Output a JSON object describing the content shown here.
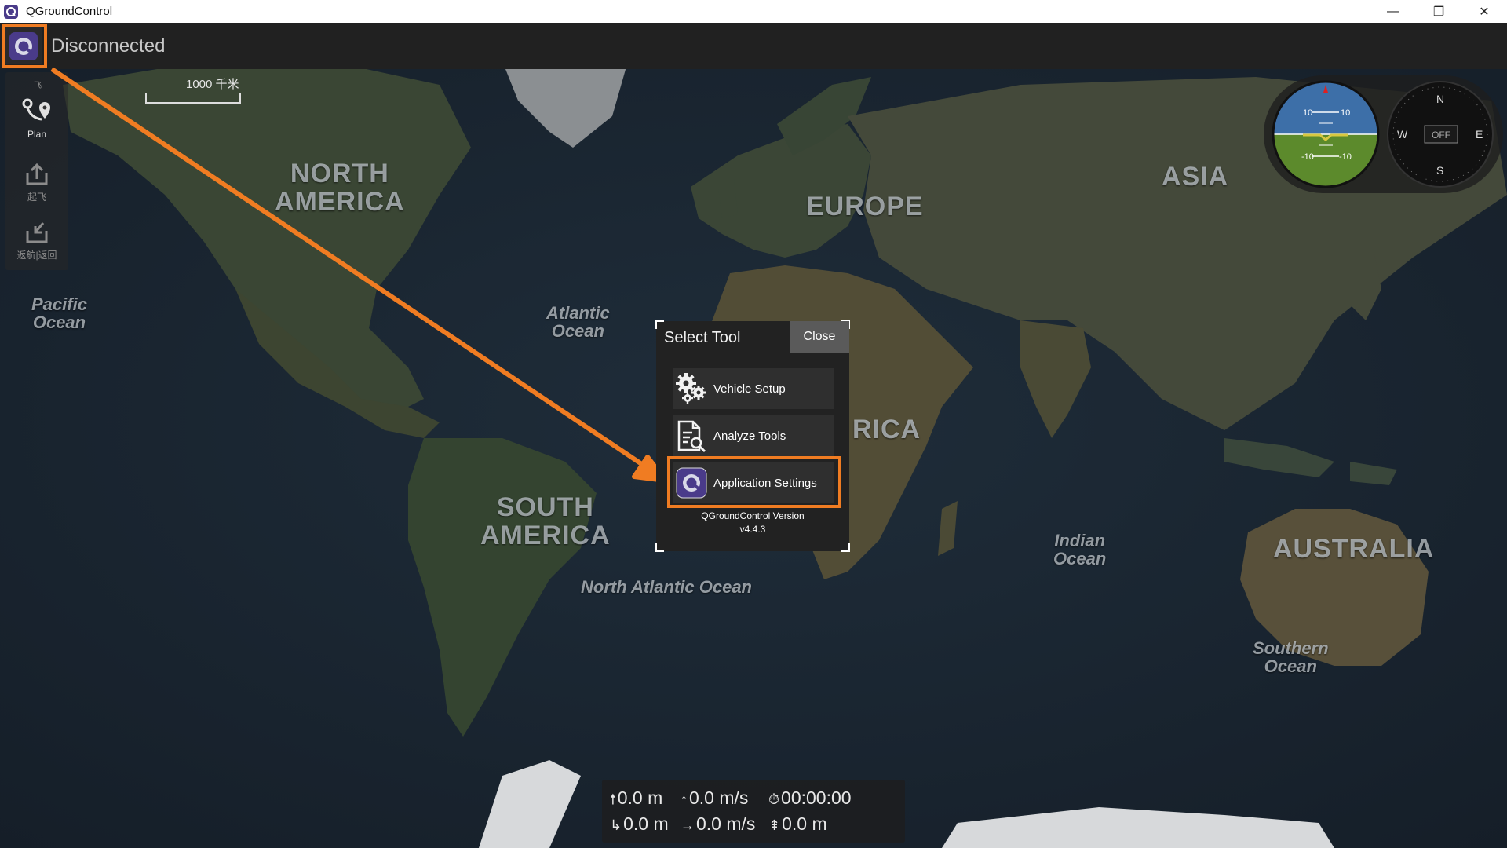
{
  "window": {
    "title": "QGroundControl",
    "controls": {
      "minimize": "—",
      "restore": "❐",
      "close": "✕"
    }
  },
  "toolbar": {
    "connection_status": "Disconnected"
  },
  "map": {
    "scale_label": "1000 千米",
    "continents": [
      "NORTH AMERICA",
      "SOUTH AMERICA",
      "EUROPE",
      "ASIA",
      "AUSTRALIA",
      "AFRICA"
    ],
    "labels": {
      "north_america": "NORTH\nAMERICA",
      "south_america": "SOUTH\nAMERICA",
      "europe": "EUROPE",
      "asia": "ASIA",
      "australia": "AUSTRALIA",
      "africa": "RICA",
      "pacific": "Pacific\nOcean",
      "atlantic": "Atlantic\nOcean",
      "north_atlantic": "North Atlantic Ocean",
      "indian": "Indian\nOcean",
      "southern": "Southern\nOcean"
    }
  },
  "left_tools": [
    {
      "label": "Plan",
      "icon": "plan-icon",
      "enabled": true
    },
    {
      "label": "起飞",
      "icon": "takeoff-icon",
      "enabled": false
    },
    {
      "label": "返航|返回",
      "icon": "return-icon",
      "enabled": false
    }
  ],
  "left_tools_top_label": "飞",
  "instruments": {
    "attitude": {
      "pitch_marks": [
        "10",
        "10",
        "-10",
        "-10"
      ]
    },
    "compass": {
      "n": "N",
      "s": "S",
      "e": "E",
      "w": "W",
      "heading_text": "OFF"
    }
  },
  "dialog": {
    "title": "Select Tool",
    "close_label": "Close",
    "items": [
      {
        "label": "Vehicle Setup",
        "icon": "gears-icon"
      },
      {
        "label": "Analyze Tools",
        "icon": "analyze-icon"
      },
      {
        "label": "Application Settings",
        "icon": "qgc-logo-icon"
      }
    ],
    "version_line1": "QGroundControl Version",
    "version_line2": "v4.4.3"
  },
  "telemetry": {
    "altitude": "0.0 m",
    "vertical_speed": "0.0 m/s",
    "flight_time": "00:00:00",
    "distance": "0.0 m",
    "horizontal_speed": "0.0 m/s",
    "distance_to_home": "0.0 m"
  },
  "colors": {
    "highlight": "#f07c22",
    "toolbar_bg": "#212121",
    "dialog_bg": "#222222",
    "accent_logo": "#4a3b8a"
  }
}
